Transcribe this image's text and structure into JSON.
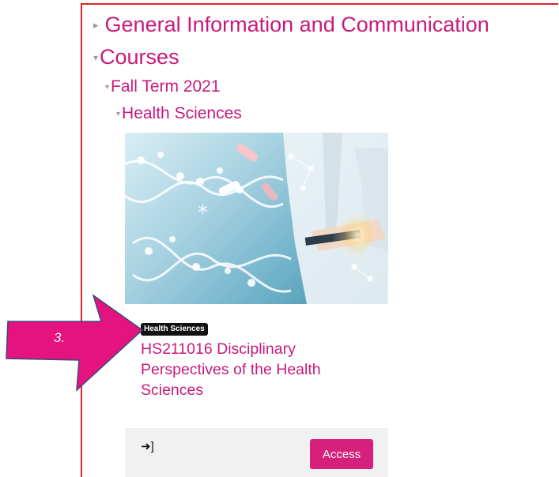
{
  "tree": {
    "items": [
      {
        "label": "General Information and Communication",
        "toggle": "▸"
      },
      {
        "label": "Courses",
        "toggle": "▾"
      },
      {
        "label": "Fall Term 2021",
        "toggle": "▾"
      },
      {
        "label": "Health Sciences",
        "toggle": "▾"
      }
    ]
  },
  "course": {
    "category": "Health Sciences",
    "title": "HS211016 Disciplinary Perspectives of the Health Sciences",
    "access_label": "Access",
    "enrol_icon": "sign-in-icon"
  },
  "callout": {
    "label": "3.",
    "color": "#e5137f"
  },
  "colors": {
    "accent": "#c8197c",
    "frame": "#e0242c",
    "button": "#d6207c"
  }
}
